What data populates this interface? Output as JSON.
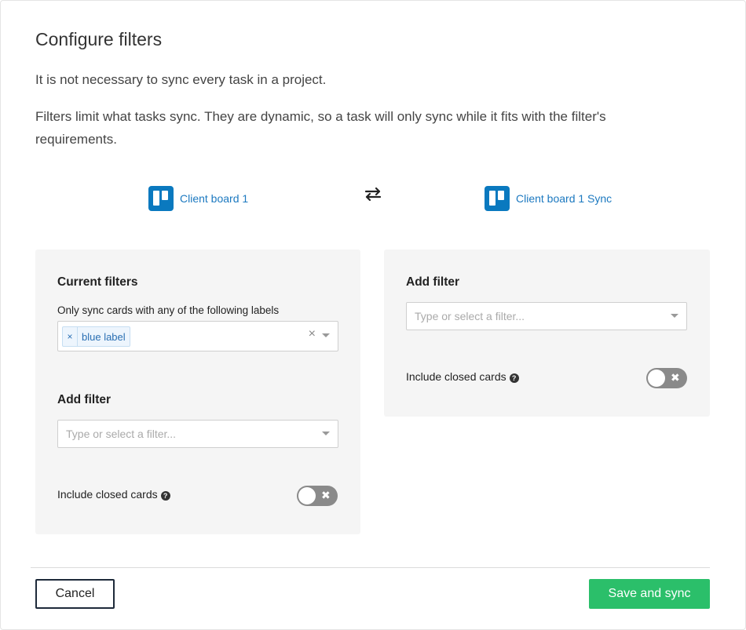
{
  "modal": {
    "title": "Configure filters",
    "intro_line1": "It is not necessary to sync every task in a project.",
    "intro_line2": "Filters limit what tasks sync. They are dynamic, so a task will only sync while it fits with the filter's requirements."
  },
  "boards": {
    "left_name": "Client board 1",
    "right_name": "Client board 1 Sync",
    "icon": "trello-icon",
    "swap_icon": "swap-arrows-icon",
    "brand_color": "#0a79bf"
  },
  "left_panel": {
    "current_filters_heading": "Current filters",
    "labels_filter_label": "Only sync cards with any of the following labels",
    "selected_tags": [
      "blue label"
    ],
    "tag_remove_glyph": "×",
    "clear_glyph": "×",
    "add_filter_heading": "Add filter",
    "add_filter_placeholder": "Type or select a filter...",
    "include_closed_label": "Include closed cards",
    "include_closed_enabled": false
  },
  "right_panel": {
    "add_filter_heading": "Add filter",
    "add_filter_placeholder": "Type or select a filter...",
    "include_closed_label": "Include closed cards",
    "include_closed_enabled": false
  },
  "help_glyph": "?",
  "toggle_off_glyph": "✖",
  "footer": {
    "cancel_label": "Cancel",
    "save_label": "Save and sync",
    "save_color": "#2bbf6a"
  }
}
